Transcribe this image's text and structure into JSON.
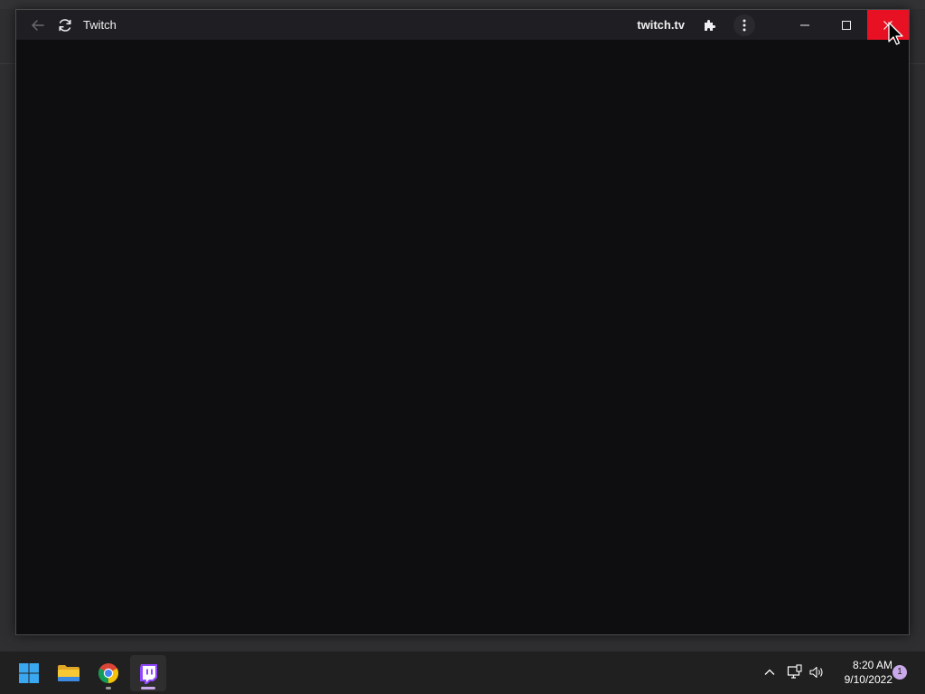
{
  "window": {
    "title": "Twitch",
    "domain": "twitch.tv"
  },
  "icons": {
    "back": "back-arrow-icon",
    "refresh": "refresh-icon",
    "extensions": "puzzle-icon",
    "menu": "kebab-menu-icon",
    "minimize": "minimize-icon",
    "maximize": "maximize-icon",
    "close": "close-icon"
  },
  "colors": {
    "titlebar": "#1f1f23",
    "content": "#0e0e10",
    "close_hover": "#e81123",
    "twitch_purple": "#9146ff"
  },
  "taskbar": {
    "apps": [
      "start-icon",
      "file-explorer-icon",
      "chrome-icon",
      "twitch-icon"
    ],
    "tray": {
      "time": "8:20 AM",
      "date": "9/10/2022",
      "notification_count": "1"
    }
  }
}
